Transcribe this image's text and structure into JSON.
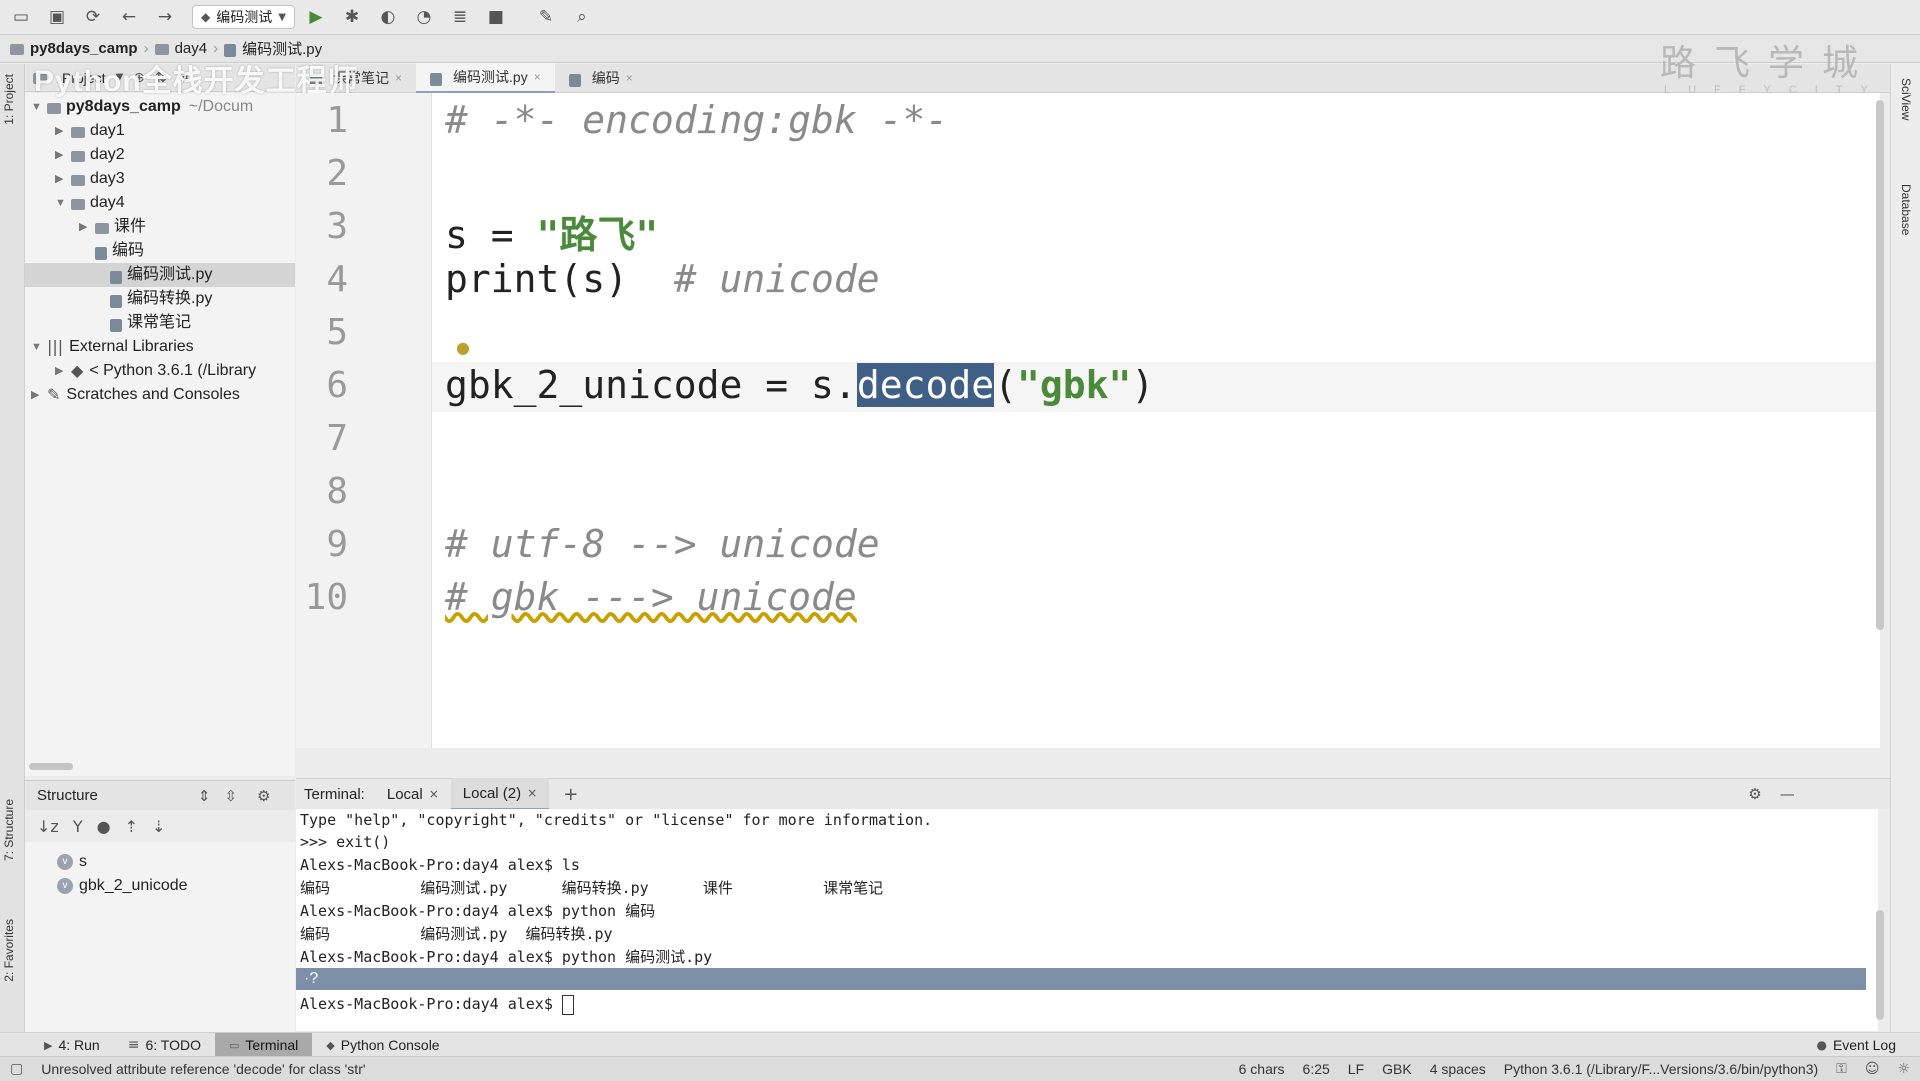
{
  "toolbar": {
    "run_config": "编码测试"
  },
  "breadcrumb": {
    "project": "py8days_camp",
    "folder": "day4",
    "file": "编码测试.py"
  },
  "watermark": {
    "course_title": "Python全栈开发工程师",
    "logo": "路飞学城",
    "logo_sub": "LUFFYCITY"
  },
  "left_strip": {
    "project": "1: Project",
    "structure": "7: Structure",
    "favorites": "2: Favorites"
  },
  "right_strip": {
    "sciview": "SciView",
    "database": "Database"
  },
  "project_panel": {
    "header": "Project",
    "root_name": "py8days_camp",
    "root_path": "~/Docum",
    "items": [
      {
        "label": "day1"
      },
      {
        "label": "day2"
      },
      {
        "label": "day3"
      },
      {
        "label": "day4"
      },
      {
        "label": "课件"
      },
      {
        "label": "编码"
      },
      {
        "label": "编码测试.py"
      },
      {
        "label": "编码转换.py"
      },
      {
        "label": "课常笔记"
      },
      {
        "label": "External Libraries"
      },
      {
        "label": "< Python 3.6.1 (/Library"
      },
      {
        "label": "Scratches and Consoles"
      }
    ]
  },
  "editor_tabs": [
    {
      "label": "课常笔记"
    },
    {
      "label": "编码测试.py"
    },
    {
      "label": "编码"
    }
  ],
  "editor": {
    "line_numbers": [
      "1",
      "2",
      "3",
      "4",
      "5",
      "6",
      "7",
      "8",
      "9",
      "10"
    ],
    "line1": "# -*- encoding:gbk -*-",
    "line3_var": "s = ",
    "line3_str": "\"路飞\"",
    "line4_code": "print(s)  ",
    "line4_comment": "# unicode",
    "line6_pre": "gbk_2_unicode = s.",
    "line6_selected": "decode",
    "line6_open": "(",
    "line6_str": "\"gbk\"",
    "line6_close": ")",
    "line9": "# utf-8 --> unicode",
    "line10": "# gbk ---> unicode"
  },
  "structure": {
    "header": "Structure",
    "items": [
      {
        "label": "s"
      },
      {
        "label": "gbk_2_unicode"
      }
    ]
  },
  "terminal": {
    "label": "Terminal:",
    "tabs": [
      {
        "label": "Local"
      },
      {
        "label": "Local (2)"
      }
    ],
    "lines": [
      "Type \"help\", \"copyright\", \"credits\" or \"license\" for more information.",
      ">>> exit()",
      "Alexs-MacBook-Pro:day4 alex$ ls",
      "编码          编码测试.py      编码转换.py      课件          课常笔记",
      "Alexs-MacBook-Pro:day4 alex$ python 编码",
      "编码          编码测试.py  编码转换.py",
      "Alexs-MacBook-Pro:day4 alex$ python 编码测试.py",
      "·?",
      "Alexs-MacBook-Pro:day4 alex$ "
    ]
  },
  "bottom_tabs": [
    {
      "label": "4: Run"
    },
    {
      "label": "6: TODO"
    },
    {
      "label": "Terminal"
    },
    {
      "label": "Python Console"
    }
  ],
  "event_log": "Event Log",
  "statusbar": {
    "message": "Unresolved attribute reference 'decode' for class 'str'",
    "chars": "6 chars",
    "position": "6:25",
    "line_sep": "LF",
    "encoding": "GBK",
    "indent": "4 spaces",
    "interpreter": "Python 3.6.1 (/Library/F...Versions/3.6/bin/python3)"
  }
}
